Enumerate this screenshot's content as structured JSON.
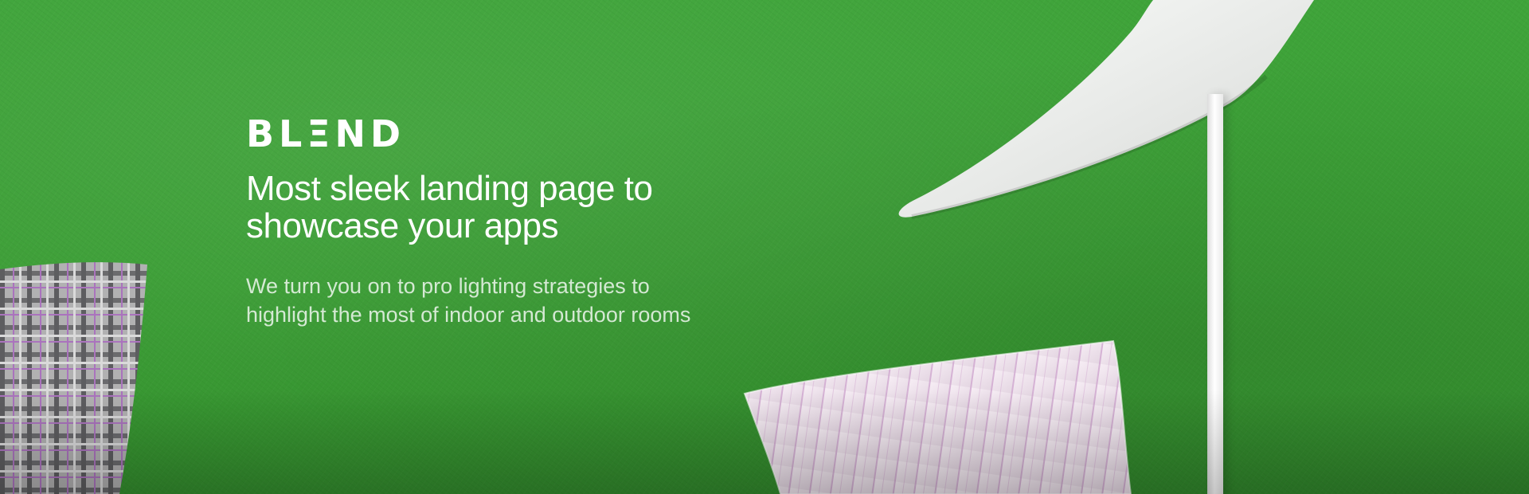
{
  "brand": {
    "logo_text": "BLΞND"
  },
  "hero": {
    "headline": "Most sleek landing page to showcase your apps",
    "subtext": "We turn you on to pro lighting strategies to highlight the most of indoor and outdoor rooms"
  },
  "colors": {
    "background": "#3fa43a",
    "text": "#ffffff"
  }
}
